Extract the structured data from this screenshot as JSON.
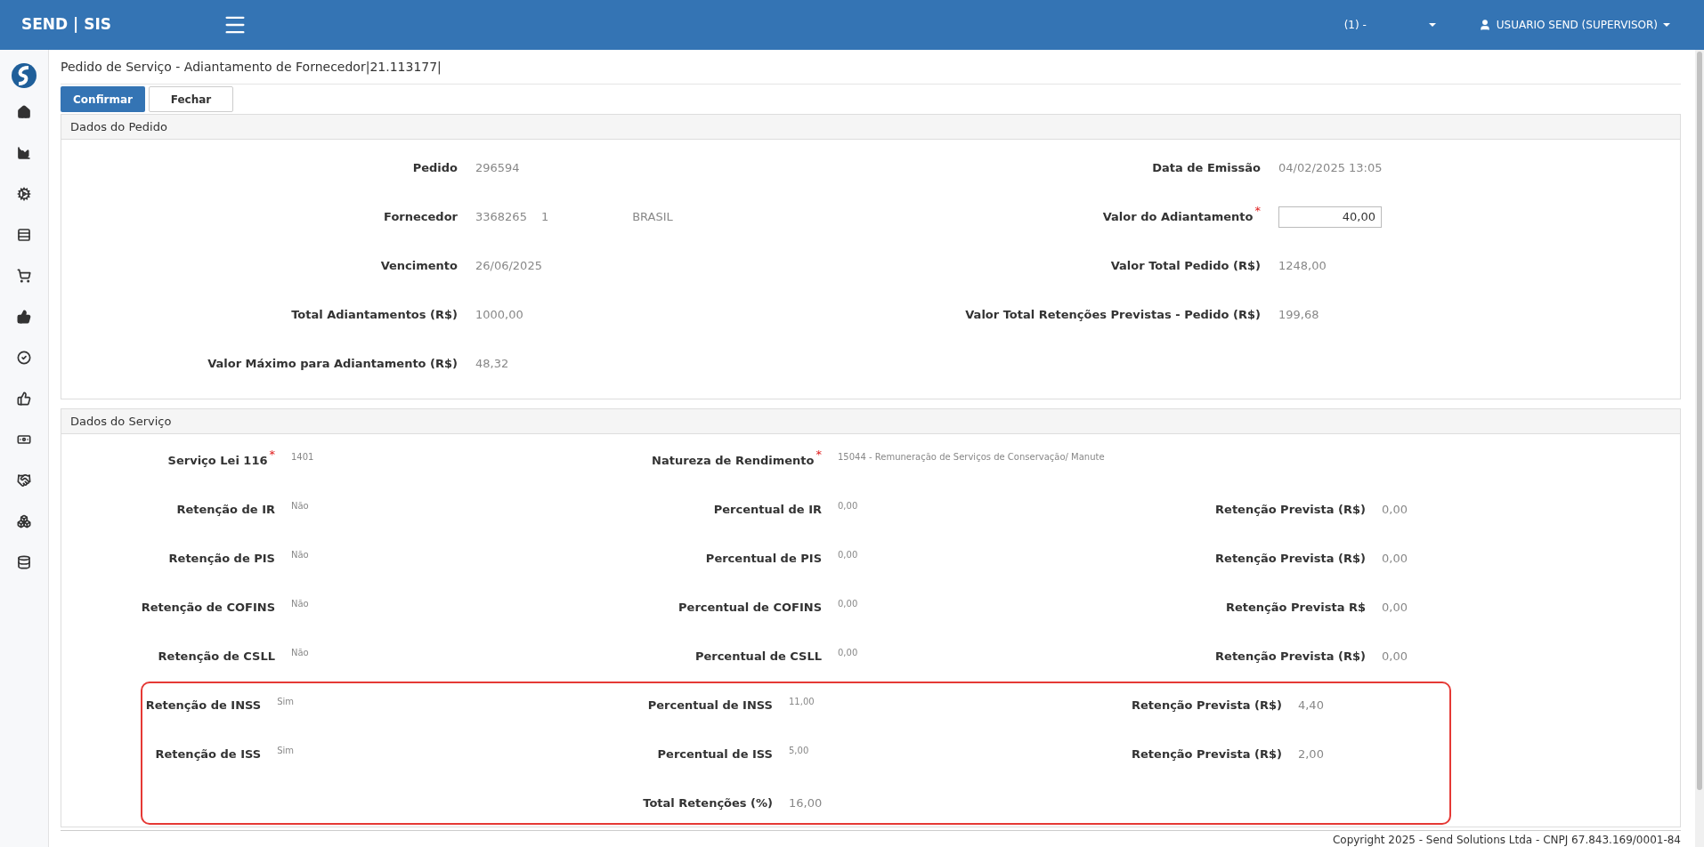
{
  "header": {
    "brand": "SEND | SIS",
    "selector": "(1) -",
    "user": "USUARIO SEND (SUPERVISOR)"
  },
  "page_title": "Pedido de Serviço - Adiantamento de Fornecedor|21.113177|",
  "buttons": [
    {
      "label": "Confirmar",
      "kind": "primary"
    },
    {
      "label": "Fechar",
      "kind": "default"
    }
  ],
  "pedido": {
    "title": "Dados do Pedido",
    "rows": [
      {
        "left": {
          "label": "Pedido",
          "values": [
            "296594"
          ]
        },
        "right": {
          "label": "Data de Emissão",
          "values": [
            "04/02/2025 13:05"
          ]
        }
      },
      {
        "left": {
          "label": "Fornecedor",
          "values": [
            "3368265",
            "1",
            "BRASIL"
          ]
        },
        "right": {
          "label": "Valor do Adiantamento",
          "required_mark": "*",
          "kind": "input",
          "values": [
            "40,00"
          ]
        }
      },
      {
        "left": {
          "label": "Vencimento",
          "values": [
            "26/06/2025"
          ]
        },
        "right": {
          "label": "Valor Total Pedido (R$)",
          "values": [
            "1248,00"
          ]
        }
      },
      {
        "left": {
          "label": "Total Adiantamentos (R$)",
          "values": [
            "1000,00"
          ]
        },
        "right": {
          "label": "Valor Total Retenções Previstas - Pedido (R$)",
          "values": [
            "199,68"
          ]
        }
      },
      {
        "left": {
          "label": "Valor Máximo para Adiantamento (R$)",
          "values": [
            "48,32"
          ]
        }
      }
    ]
  },
  "servico": {
    "title": "Dados do Serviço",
    "rows": [
      {
        "cells": [
          {
            "label": "Serviço Lei 116",
            "required_mark": "*",
            "value": "1401",
            "kind": "compact"
          },
          {
            "label": "Natureza de Rendimento",
            "required_mark": "*",
            "value": "15044 - Remuneração de Serviços de Conservação/ Manute",
            "kind": "compact"
          }
        ]
      },
      {
        "cells": [
          {
            "label": "Retenção de IR",
            "value": "Não",
            "kind": "compact"
          },
          {
            "label": "Percentual de IR",
            "value": "0,00",
            "kind": "compact"
          },
          {
            "label": "Retenção Prevista (R$)",
            "value": "0,00",
            "kind": "plain"
          }
        ]
      },
      {
        "cells": [
          {
            "label": "Retenção de PIS",
            "value": "Não",
            "kind": "compact"
          },
          {
            "label": "Percentual de PIS",
            "value": "0,00",
            "kind": "compact"
          },
          {
            "label": "Retenção Prevista (R$)",
            "value": "0,00",
            "kind": "plain"
          }
        ]
      },
      {
        "cells": [
          {
            "label": "Retenção de COFINS",
            "value": "Não",
            "kind": "compact"
          },
          {
            "label": "Percentual de COFINS",
            "value": "0,00",
            "kind": "compact"
          },
          {
            "label": "Retenção Prevista R$",
            "value": "0,00",
            "kind": "plain"
          }
        ]
      },
      {
        "cells": [
          {
            "label": "Retenção de CSLL",
            "value": "Não",
            "kind": "compact"
          },
          {
            "label": "Percentual de CSLL",
            "value": "0,00",
            "kind": "compact"
          },
          {
            "label": "Retenção Prevista (R$)",
            "value": "0,00",
            "kind": "plain"
          }
        ]
      }
    ],
    "highlighted_rows": [
      {
        "cells": [
          {
            "label": "Retenção de INSS",
            "value": "Sim",
            "kind": "compact"
          },
          {
            "label": "Percentual de INSS",
            "value": "11,00",
            "kind": "compact"
          },
          {
            "label": "Retenção Prevista (R$)",
            "value": "4,40",
            "kind": "plain"
          }
        ]
      },
      {
        "cells": [
          {
            "label": "Retenção de ISS",
            "value": "Sim",
            "kind": "compact"
          },
          {
            "label": "Percentual de ISS",
            "value": "5,00",
            "kind": "compact"
          },
          {
            "label": "Retenção Prevista (R$)",
            "value": "2,00",
            "kind": "plain"
          }
        ]
      },
      {
        "cells": [
          null,
          {
            "label": "Total Retenções (%)",
            "value": "16,00",
            "kind": "plain"
          }
        ]
      }
    ]
  },
  "footer": "Copyright 2025 - Send Solutions Ltda - CNPJ 67.843.169/0001-84"
}
